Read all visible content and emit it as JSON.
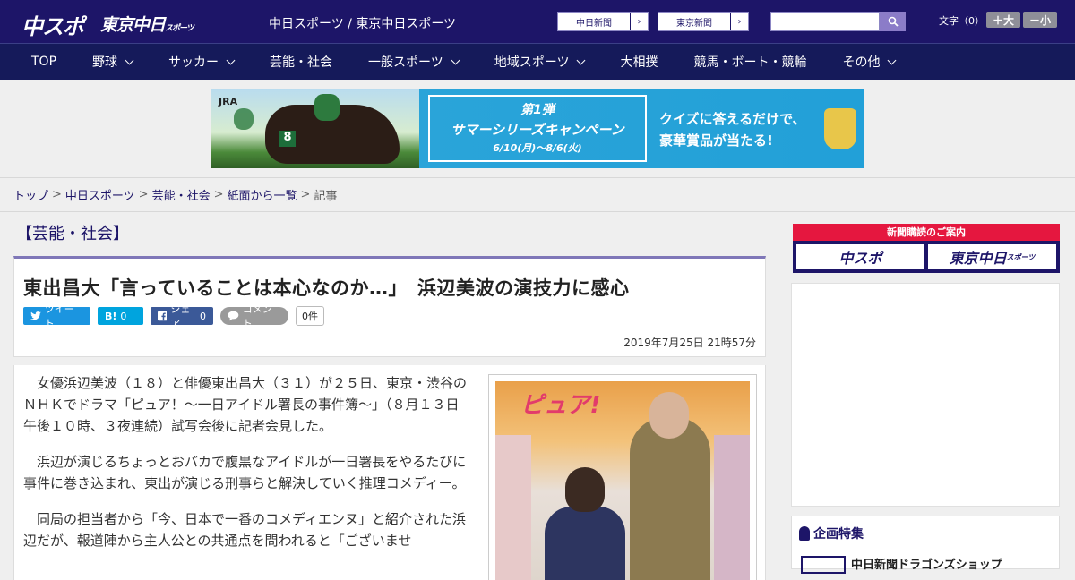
{
  "header": {
    "logo_main": "中スポ",
    "logo_tokyo": "東京中日",
    "logo_tokyo_sub": "スポーツ",
    "site_links": "中日スポーツ / 東京中日スポーツ",
    "ext_links": [
      {
        "label": "中日新聞",
        "arrow": "›"
      },
      {
        "label": "東京新聞",
        "arrow": "›"
      }
    ],
    "search": {
      "placeholder": "",
      "value": ""
    },
    "font_size_label": "文字（0）",
    "font_bigger": "＋大",
    "font_smaller": "－小"
  },
  "nav": {
    "items": [
      {
        "label": "TOP",
        "has_dropdown": false
      },
      {
        "label": "野球",
        "has_dropdown": true
      },
      {
        "label": "サッカー",
        "has_dropdown": true
      },
      {
        "label": "芸能・社会",
        "has_dropdown": false
      },
      {
        "label": "一般スポーツ",
        "has_dropdown": true
      },
      {
        "label": "地域スポーツ",
        "has_dropdown": true
      },
      {
        "label": "大相撲",
        "has_dropdown": false
      },
      {
        "label": "競馬・ボート・競輪",
        "has_dropdown": false
      },
      {
        "label": "その他",
        "has_dropdown": true
      }
    ]
  },
  "banner": {
    "brand": "JRA",
    "number": "8",
    "campaign_line1": "第1弾",
    "campaign_line2": "サマーシリーズキャンペーン",
    "campaign_line3": "6/10(月)～8/6(火)",
    "promo_line1": "クイズに答えるだけで、",
    "promo_line2": "豪華賞品が当たる!"
  },
  "breadcrumb": {
    "items": [
      "トップ",
      "中日スポーツ",
      "芸能・社会",
      "紙面から一覧"
    ],
    "current": "記事",
    "separator": ">"
  },
  "article": {
    "category": "【芸能・社会】",
    "headline": "東出昌大「言っていることは本心なのか…」　浜辺美波の演技力に感心",
    "share": {
      "tweet": "ツイート",
      "hatena": "B!",
      "hatena_count": "0",
      "facebook": "シェア",
      "facebook_count": "0",
      "comment": "コメント",
      "comment_count": "0件"
    },
    "date": "2019年7月25日 21時57分",
    "paragraphs": [
      "女優浜辺美波（１８）と俳優東出昌大（３１）が２５日、東京・渋谷のＮＨＫでドラマ「ピュア！～一日アイドル署長の事件簿～」（８月１３日午後１０時、３夜連続）試写会後に記者会見した。",
      "浜辺が演じるちょっとおバカで腹黒なアイドルが一日署長をやるたびに事件に巻き込まれ、東出が演じる刑事らと解決していく推理コメディー。",
      "同局の担当者から「今、日本で一番のコメディエンヌ」と紹介された浜辺だが、報道陣から主人公との共通点を問われると「ございませ"
    ],
    "photo_title": "ピュア!"
  },
  "sidebar": {
    "ad_title": "新聞購読のご案内",
    "ad_left": "中スポ",
    "ad_right": "東京中日",
    "ad_right_sub": "スポーツ",
    "feature_title": "企画特集",
    "feature_item": "中日新聞ドラゴンズショップ"
  },
  "colors": {
    "header_bg": "#1d1568",
    "nav_bg": "#151a5a",
    "accent_red": "#e5173f",
    "twitter": "#1b95e0",
    "facebook": "#3b5998"
  }
}
